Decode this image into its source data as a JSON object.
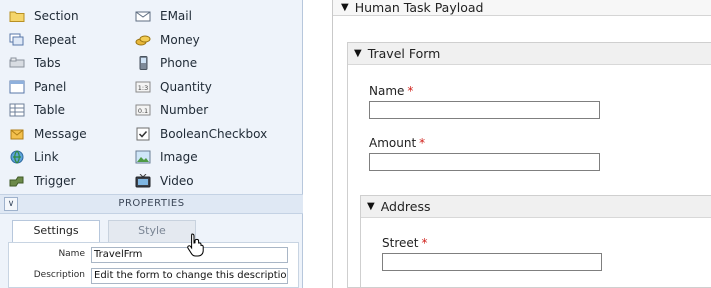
{
  "palette": {
    "col1": [
      {
        "label": "Section",
        "icon": "folder-icon"
      },
      {
        "label": "Repeat",
        "icon": "repeat-icon"
      },
      {
        "label": "Tabs",
        "icon": "tabs-icon"
      },
      {
        "label": "Panel",
        "icon": "panel-icon"
      },
      {
        "label": "Table",
        "icon": "table-icon"
      },
      {
        "label": "Message",
        "icon": "message-icon"
      },
      {
        "label": "Link",
        "icon": "link-icon"
      },
      {
        "label": "Trigger",
        "icon": "trigger-icon"
      }
    ],
    "col2": [
      {
        "label": "EMail",
        "icon": "email-icon"
      },
      {
        "label": "Money",
        "icon": "money-icon"
      },
      {
        "label": "Phone",
        "icon": "phone-icon"
      },
      {
        "label": "Quantity",
        "icon": "quantity-icon"
      },
      {
        "label": "Number",
        "icon": "number-icon"
      },
      {
        "label": "BooleanCheckbox",
        "icon": "checkbox-icon"
      },
      {
        "label": "Image",
        "icon": "image-icon"
      },
      {
        "label": "Video",
        "icon": "video-icon"
      }
    ]
  },
  "properties": {
    "title": "PROPERTIES",
    "tabs": {
      "settings": "Settings",
      "style": "Style"
    },
    "name_label": "Name",
    "name_value": "TravelFrm",
    "description_label": "Description",
    "description_value": "Edit the form to change this description."
  },
  "form": {
    "payload_title": "Human Task Payload",
    "travel_title": "Travel Form",
    "name_label": "Name",
    "amount_label": "Amount",
    "address_title": "Address",
    "street_label": "Street",
    "required_mark": "*"
  }
}
